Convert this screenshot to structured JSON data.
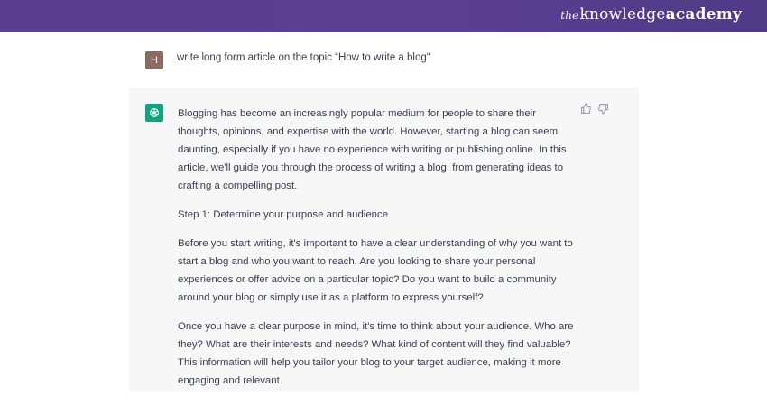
{
  "brand": {
    "prefix": "the",
    "mid": "knowledge",
    "suffix": "academy"
  },
  "user": {
    "avatar_letter": "H",
    "message": "write long form article on the topic “How to write a blog“"
  },
  "assistant": {
    "icon": "openai-logo-icon",
    "feedback": [
      "thumbs-up-icon",
      "thumbs-down-icon"
    ],
    "paragraphs": [
      "Blogging has become an increasingly popular medium for people to share their thoughts, opinions, and expertise with the world. However, starting a blog can seem daunting, especially if you have no experience with writing or publishing online. In this article, we'll guide you through the process of writing a blog, from generating ideas to crafting a compelling post.",
      "Step 1: Determine your purpose and audience",
      "Before you start writing, it's important to have a clear understanding of why you want to start a blog and who you want to reach. Are you looking to share your personal experiences or offer advice on a particular topic? Do you want to build a community around your blog or simply use it as a platform to express yourself?",
      "Once you have a clear purpose in mind, it's time to think about your audience. Who are they? What are their interests and needs? What kind of content will they find valuable? This information will help you tailor your blog to your target audience, making it more engaging and relevant."
    ]
  },
  "colors": {
    "banner": "#5a3f8e",
    "user_avatar": "#8b6a5f",
    "bot_avatar": "#10a37f",
    "assistant_bg": "#f7f7f8",
    "text": "#374151"
  }
}
